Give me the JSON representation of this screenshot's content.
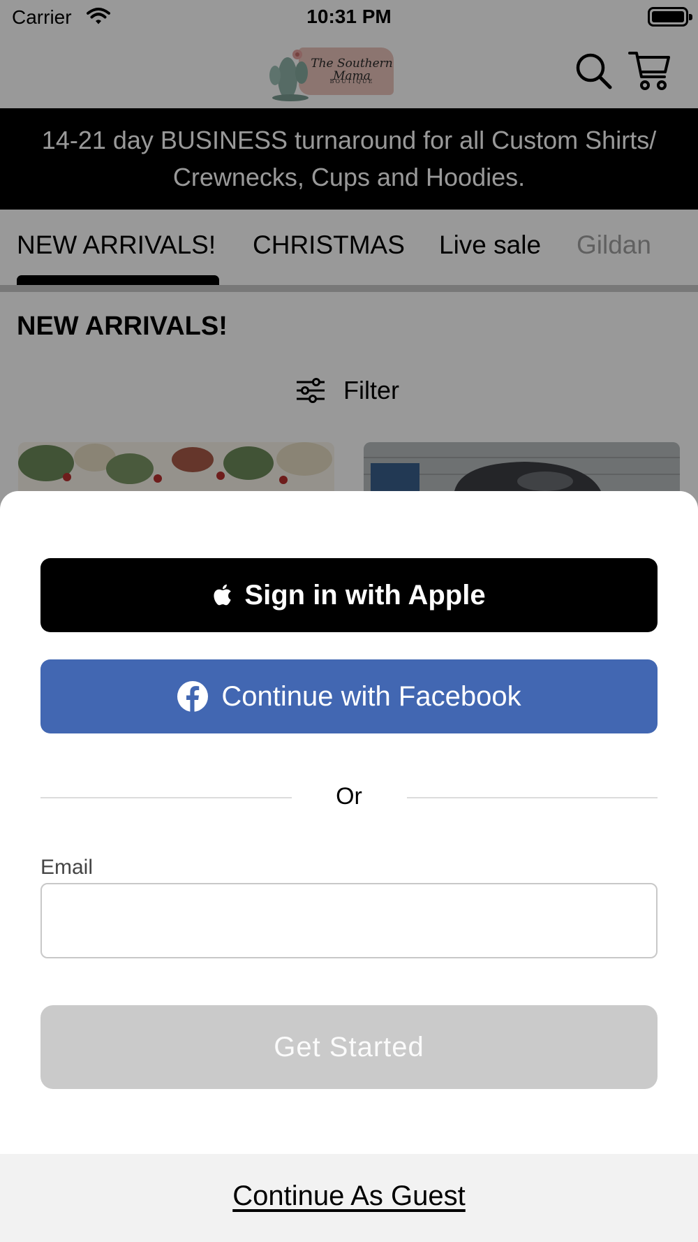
{
  "status_bar": {
    "carrier": "Carrier",
    "time": "10:31 PM"
  },
  "header": {
    "logo_text_line1": "The Southern Mama",
    "logo_text_line2": "BOUTIQUE",
    "icons": [
      "search-icon",
      "cart-icon"
    ]
  },
  "banner": {
    "line1": "14-21 day BUSINESS turnaround for all Custom Shirts/",
    "line2": "Crewnecks, Cups and Hoodies."
  },
  "tabs": [
    {
      "label": "NEW ARRIVALS!",
      "selected": true
    },
    {
      "label": "CHRISTMAS",
      "selected": false
    },
    {
      "label": "Live sale",
      "selected": false
    },
    {
      "label": "Gildan",
      "selected": false
    }
  ],
  "content": {
    "section_title": "NEW ARRIVALS!",
    "filter_label": "Filter"
  },
  "sheet": {
    "apple_button": "Sign in with Apple",
    "facebook_button": "Continue with Facebook",
    "or_text": "Or",
    "email_label": "Email",
    "email_value": "",
    "get_started_button": "Get Started",
    "guest_link": "Continue As Guest"
  },
  "colors": {
    "facebook_blue": "#4267b2",
    "disabled_gray": "#cacaca",
    "banner_black": "#000000",
    "logo_blush": "#e9c4bb"
  }
}
